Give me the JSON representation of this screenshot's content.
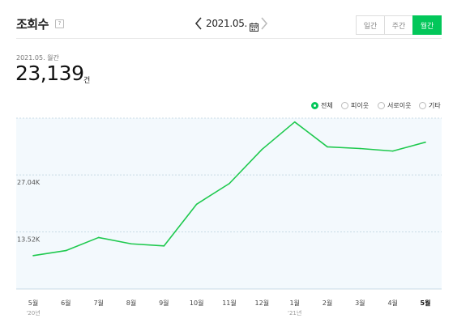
{
  "header": {
    "title": "조회수",
    "help_glyph": "?",
    "date": "2021.05.",
    "calendar_icon": "calendar-icon",
    "prev_icon": "chevron-left-icon",
    "next_icon": "chevron-right-icon",
    "period_tabs": [
      {
        "label": "일간",
        "active": false
      },
      {
        "label": "주간",
        "active": false
      },
      {
        "label": "월간",
        "active": true
      }
    ]
  },
  "summary": {
    "period_label": "2021.05. 월간",
    "total": "23,139",
    "unit": "건"
  },
  "filters": [
    {
      "label": "전체",
      "selected": true
    },
    {
      "label": "피이웃",
      "selected": false
    },
    {
      "label": "서로이웃",
      "selected": false
    },
    {
      "label": "기타",
      "selected": false
    }
  ],
  "colors": {
    "accent": "#03c75a",
    "line": "#1ec94e",
    "plot_bg": "#f3f9fd",
    "grid": "#c9dbe6"
  },
  "chart_data": {
    "type": "line",
    "categories": [
      "5월",
      "6월",
      "7월",
      "8월",
      "9월",
      "10월",
      "11월",
      "12월",
      "1월",
      "2월",
      "3월",
      "4월",
      "5월"
    ],
    "year_labels": [
      {
        "index": 0,
        "label": "'20년"
      },
      {
        "index": 8,
        "label": "'21년"
      }
    ],
    "series": [
      {
        "values": [
          7900,
          9100,
          12200,
          10700,
          10200,
          20100,
          25000,
          33100,
          39600,
          33700,
          33300,
          32700,
          34800
        ]
      }
    ],
    "ylim": [
      0,
      40500
    ],
    "yticks": [
      13520,
      27040
    ],
    "ytick_labels": [
      "13.52K",
      "27.04K"
    ],
    "grid": true
  }
}
